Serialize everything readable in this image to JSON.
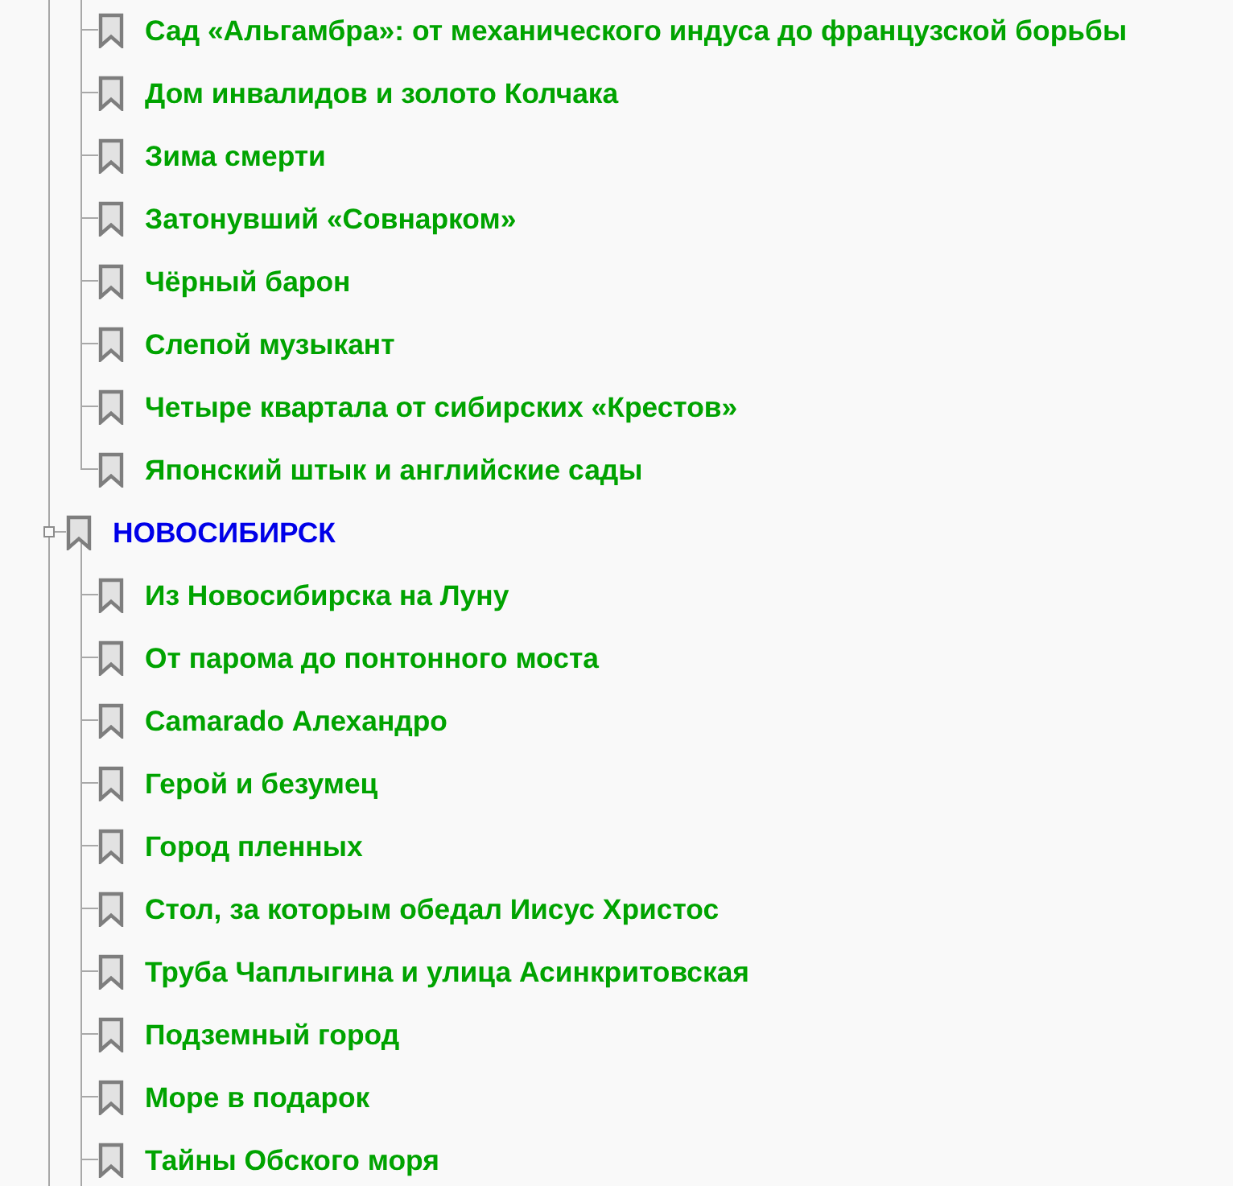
{
  "outline": {
    "items": [
      {
        "children": [
          {
            "title": "Сад «Альгамбра»: от механического индуса до французской борьбы"
          },
          {
            "title": "Дом инвалидов и золото Колчака"
          },
          {
            "title": "Зима смерти"
          },
          {
            "title": "Затонувший «Совнарком»"
          },
          {
            "title": "Чёрный барон"
          },
          {
            "title": "Слепой музыкант"
          },
          {
            "title": "Четыре квартала от сибирских «Крестов»"
          },
          {
            "title": "Японский штык и английские сады"
          }
        ]
      },
      {
        "title": "НОВОСИБИРСК",
        "expanded": true,
        "children": [
          {
            "title": "Из Новосибирска на Луну"
          },
          {
            "title": "От парома до понтонного моста"
          },
          {
            "title": "Camarado Алехандро"
          },
          {
            "title": "Герой и безумец"
          },
          {
            "title": "Город пленных"
          },
          {
            "title": "Стол, за которым обедал Иисус Христос"
          },
          {
            "title": "Труба Чаплыгина и улица Асинкритовская"
          },
          {
            "title": "Подземный город"
          },
          {
            "title": "Море в подарок"
          },
          {
            "title": "Тайны Обского моря"
          }
        ]
      }
    ]
  }
}
